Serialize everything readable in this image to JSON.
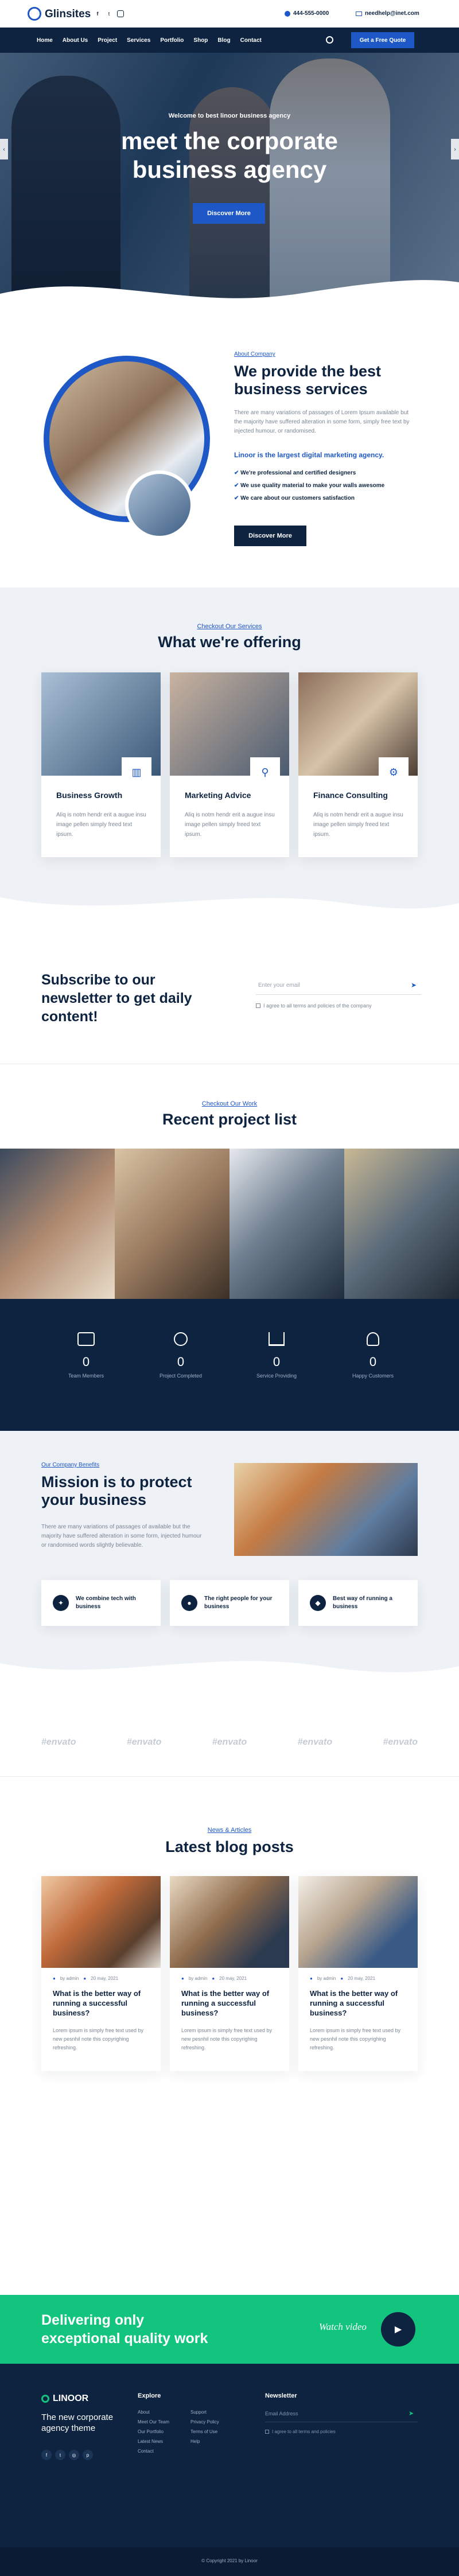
{
  "brand": {
    "name": "Glinsites",
    "accent": "#1e58c7",
    "navy": "#0d2340",
    "green": "#12c47e"
  },
  "header": {
    "social": [
      "facebook-icon",
      "twitter-icon",
      "instagram-icon"
    ],
    "phone": "444-555-0000",
    "email": "needhelp@inet.com",
    "nav": [
      "Home",
      "About Us",
      "Project",
      "Services",
      "Portfolio",
      "Shop",
      "Blog",
      "Contact"
    ],
    "cta": "Get a Free Quote"
  },
  "hero": {
    "eyebrow": "Welcome to best linoor business agency",
    "title_line1": "meet the corporate",
    "title_line2": "business agency",
    "button": "Discover More"
  },
  "about": {
    "eyebrow": "About Company",
    "title": "We provide the best business services",
    "text": "There are many variations of passages of Lorem Ipsum available but the majority have suffered alteration in some form, simply free text by injected humour, or randomised.",
    "highlight": "Linoor is the largest digital marketing agency.",
    "bullets": [
      "We're professional and certified designers",
      "We use quality material to make your walls awesome",
      "We care about our customers satisfaction"
    ],
    "button": "Discover More"
  },
  "services": {
    "eyebrow": "Checkout Our Services",
    "title": "What we're offering",
    "items": [
      {
        "title": "Business Growth",
        "text": "Aliq is notm hendr erit a augue insu image pellen simply freed text ipsum."
      },
      {
        "title": "Marketing Advice",
        "text": "Aliq is notm hendr erit a augue insu image pellen simply freed text ipsum."
      },
      {
        "title": "Finance Consulting",
        "text": "Aliq is notm hendr erit a augue insu image pellen simply freed text ipsum."
      }
    ]
  },
  "newsletter": {
    "title": "Subscribe to our newsletter to get daily content!",
    "placeholder": "Enter your email",
    "agree": "I agree to all terms and policies of the company"
  },
  "projects": {
    "eyebrow": "Checkout Our Work",
    "title": "Recent project list"
  },
  "counters": [
    {
      "value": "0",
      "label": "Team Members"
    },
    {
      "value": "0",
      "label": "Project Completed"
    },
    {
      "value": "0",
      "label": "Service Providing"
    },
    {
      "value": "0",
      "label": "Happy Customers"
    }
  ],
  "mission": {
    "eyebrow": "Our Company Benefits",
    "title": "Mission is to protect your business",
    "text": "There are many variations of passages of available but the majority have suffered alteration in some form, injected humour or randomised words slightly believable.",
    "features": [
      {
        "label": "We combine tech with business"
      },
      {
        "label": "The right people for your business"
      },
      {
        "label": "Best way of running a business"
      }
    ]
  },
  "clients": [
    "#envato",
    "#envato",
    "#envato",
    "#envato",
    "#envato"
  ],
  "blog": {
    "eyebrow": "News & Articles",
    "title": "Latest blog posts",
    "posts": [
      {
        "author": "by admin",
        "date": "20 may, 2021",
        "title": "What is the better way of running a successful business?",
        "text": "Lorem ipsum is simply free text used by new pesnhil note this copyrighing refreshing."
      },
      {
        "author": "by admin",
        "date": "20 may, 2021",
        "title": "What is the better way of running a successful business?",
        "text": "Lorem ipsum is simply free text used by new pesnhil note this copyrighing refreshing."
      },
      {
        "author": "by admin",
        "date": "20 may, 2021",
        "title": "What is the better way of running a successful business?",
        "text": "Lorem ipsum is simply free text used by new pesnhil note this copyrighing refreshing."
      }
    ]
  },
  "cta": {
    "title": "Delivering only exceptional quality work",
    "video": "Watch video"
  },
  "footer": {
    "logo": "LINOOR",
    "tagline": "The new corporate agency theme",
    "explore_title": "Explore",
    "explore_col1": [
      "About",
      "Meet Our Team",
      "Our Portfolio",
      "Latest News",
      "Contact"
    ],
    "explore_col2": [
      "Support",
      "Privacy Policy",
      "Terms of Use",
      "Help"
    ],
    "newsletter_title": "Newsletter",
    "newsletter_placeholder": "Email Address",
    "newsletter_agree": "I agree to all terms and policies",
    "copyright": "© Copyright 2021 by Linoor"
  }
}
